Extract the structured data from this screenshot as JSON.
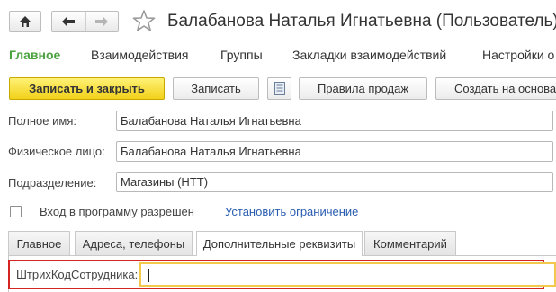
{
  "window": {
    "title": "Балабанова Наталья Игнатьевна (Пользователь)",
    "icons": [
      "home-icon",
      "back-arrow-icon",
      "forward-arrow-icon",
      "star-icon"
    ]
  },
  "sections": [
    {
      "label": "Главное",
      "active": true
    },
    {
      "label": "Взаимодействия",
      "active": false
    },
    {
      "label": "Группы",
      "active": false
    },
    {
      "label": "Закладки взаимодействий",
      "active": false
    },
    {
      "label": "Настройки о",
      "active": false
    }
  ],
  "toolbar": {
    "save_close_label": "Записать и закрыть",
    "save_label": "Записать",
    "doc_icon": "document-list-icon",
    "rules_label": "Правила продаж",
    "create_label": "Создать на основа"
  },
  "form": {
    "full_name_label": "Полное имя:",
    "full_name_value": "Балабанова Наталья Игнатьевна",
    "person_label": "Физическое лицо:",
    "person_value": "Балабанова Наталья Игнатьевна",
    "department_label": "Подразделение:",
    "department_value": "Магазины (НТТ)",
    "login_allowed_label": "Вход в программу разрешен",
    "login_allowed_checked": false,
    "restrict_link": "Установить ограничение"
  },
  "tabs": [
    {
      "label": "Главное",
      "active": false
    },
    {
      "label": "Адреса, телефоны",
      "active": false
    },
    {
      "label": "Дополнительные реквизиты",
      "active": true
    },
    {
      "label": "Комментарий",
      "active": false
    }
  ],
  "extra": {
    "barcode_label": "ШтрихКодСотрудника:",
    "barcode_value": ""
  },
  "colors": {
    "accent_green": "#4aa23f",
    "primary_button": "#f2d21b",
    "highlight_red": "#d42424",
    "focus_yellow": "#f2c94c",
    "link_blue": "#2a5db0"
  }
}
